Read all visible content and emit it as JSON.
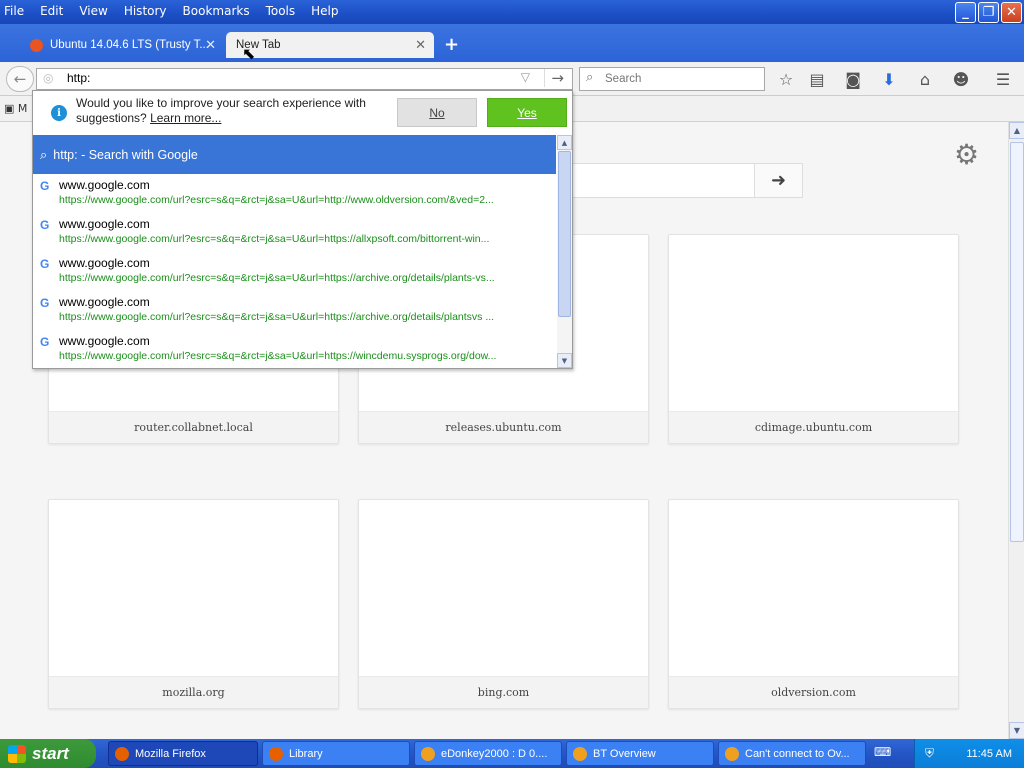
{
  "menu": [
    "File",
    "Edit",
    "View",
    "History",
    "Bookmarks",
    "Tools",
    "Help"
  ],
  "tabs": [
    {
      "label": "Ubuntu 14.04.6 LTS (Trusty T..."
    },
    {
      "label": "New Tab"
    }
  ],
  "urlbar": {
    "value": "http:"
  },
  "searchbar": {
    "placeholder": "Search"
  },
  "bookmarks": {
    "first": "M"
  },
  "notice": {
    "text": "Would you like to improve your search experience with suggestions?",
    "link": "Learn more...",
    "no": "No",
    "yes": "Yes"
  },
  "selected_row": "http: - Search with Google",
  "results": [
    {
      "title": "www.google.com",
      "url": "https://www.google.com/url?esrc=s&q=&rct=j&sa=U&url=http://www.oldversion.com/&ved=2..."
    },
    {
      "title": "www.google.com",
      "url": "https://www.google.com/url?esrc=s&q=&rct=j&sa=U&url=https://allxpsoft.com/bittorrent-win..."
    },
    {
      "title": "www.google.com",
      "url": "https://www.google.com/url?esrc=s&q=&rct=j&sa=U&url=https://archive.org/details/plants-vs..."
    },
    {
      "title": "www.google.com",
      "url": "https://www.google.com/url?esrc=s&q=&rct=j&sa=U&url=https://archive.org/details/plantsvs ..."
    },
    {
      "title": "www.google.com",
      "url": "https://www.google.com/url?esrc=s&q=&rct=j&sa=U&url=https://wincdemu.sysprogs.org/dow..."
    }
  ],
  "tiles": [
    "router.collabnet.local",
    "releases.ubuntu.com",
    "cdimage.ubuntu.com",
    "mozilla.org",
    "bing.com",
    "oldversion.com"
  ],
  "taskbar": {
    "start": "start",
    "tasks": [
      "Mozilla Firefox",
      "Library",
      "eDonkey2000 : D 0....",
      "BT Overview",
      "Can't connect to Ov..."
    ],
    "clock": "11:45 AM"
  },
  "colors": {
    "accent": "#3875d7",
    "yes": "#5fc21f",
    "url_green": "#1a8f1a"
  }
}
